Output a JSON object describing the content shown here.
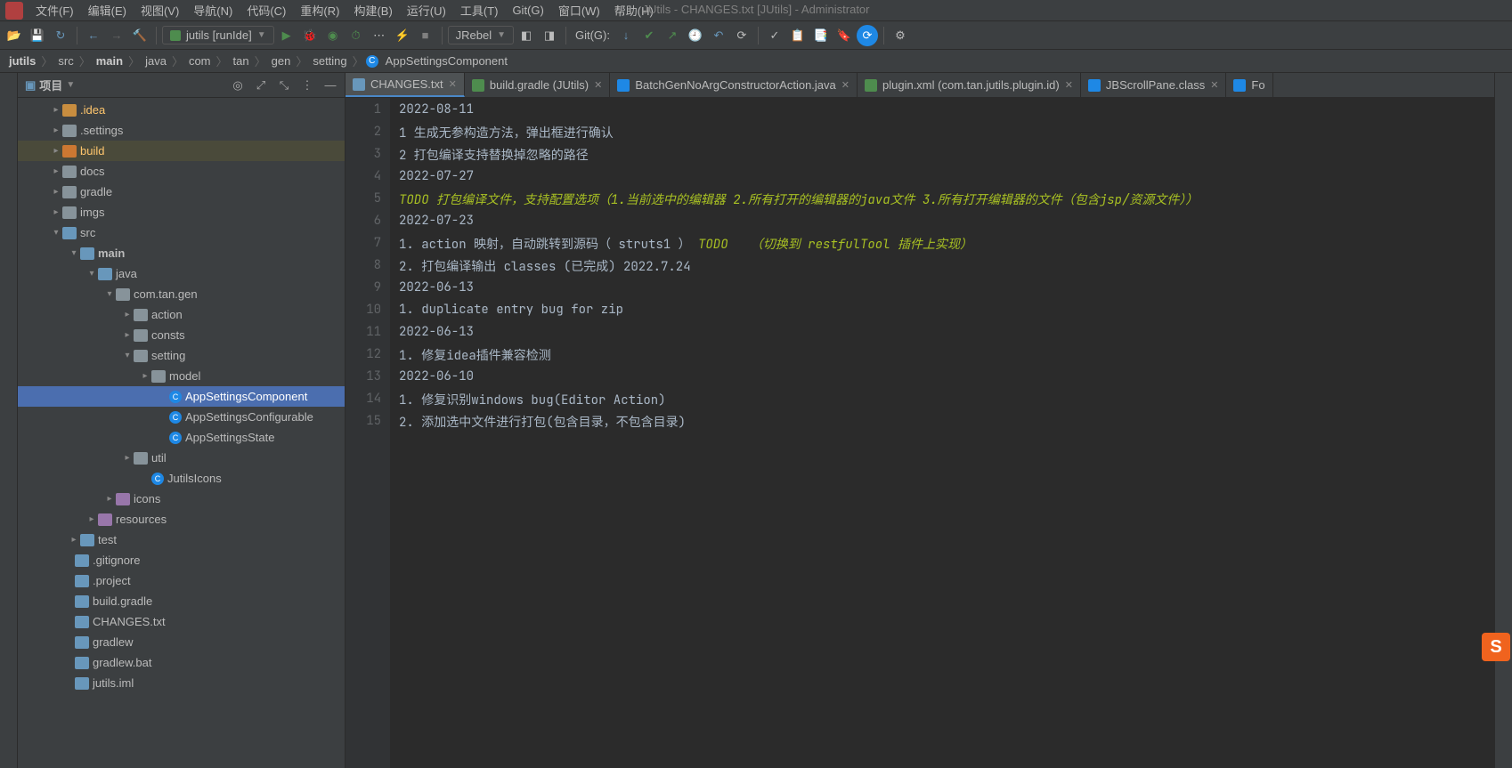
{
  "window_title": "JUtils - CHANGES.txt [JUtils] - Administrator",
  "menu": {
    "items": [
      "文件(F)",
      "编辑(E)",
      "视图(V)",
      "导航(N)",
      "代码(C)",
      "重构(R)",
      "构建(B)",
      "运行(U)",
      "工具(T)",
      "Git(G)",
      "窗口(W)",
      "帮助(H)"
    ]
  },
  "toolbar": {
    "run_config_label": "jutils [runIde]",
    "jrebel_label": "JRebel",
    "git_label": "Git(G):"
  },
  "breadcrumb": {
    "parts": [
      "jutils",
      "src",
      "main",
      "java",
      "com",
      "tan",
      "gen",
      "setting",
      "AppSettingsComponent"
    ]
  },
  "project": {
    "title": "项目",
    "tree": [
      {
        "indent": 36,
        "chevron": ">",
        "icon": "folder-orange",
        "label": ".idea",
        "yellow": true
      },
      {
        "indent": 36,
        "chevron": ">",
        "icon": "folder-icon",
        "label": ".settings"
      },
      {
        "indent": 36,
        "chevron": ">",
        "icon": "folder-red-sq",
        "label": "build",
        "yellow": true,
        "highlight": true
      },
      {
        "indent": 36,
        "chevron": ">",
        "icon": "folder-icon",
        "label": "docs"
      },
      {
        "indent": 36,
        "chevron": ">",
        "icon": "folder-icon",
        "label": "gradle"
      },
      {
        "indent": 36,
        "chevron": ">",
        "icon": "folder-icon",
        "label": "imgs"
      },
      {
        "indent": 36,
        "chevron": "v",
        "icon": "folder-blue",
        "label": "src"
      },
      {
        "indent": 56,
        "chevron": "v",
        "icon": "folder-blue",
        "label": "main",
        "bold": true
      },
      {
        "indent": 76,
        "chevron": "v",
        "icon": "folder-blue",
        "label": "java"
      },
      {
        "indent": 96,
        "chevron": "v",
        "icon": "folder-icon",
        "label": "com.tan.gen"
      },
      {
        "indent": 116,
        "chevron": ">",
        "icon": "folder-icon",
        "label": "action"
      },
      {
        "indent": 116,
        "chevron": ">",
        "icon": "folder-icon",
        "label": "consts"
      },
      {
        "indent": 116,
        "chevron": "v",
        "icon": "folder-icon",
        "label": "setting"
      },
      {
        "indent": 136,
        "chevron": ">",
        "icon": "folder-icon",
        "label": "model"
      },
      {
        "indent": 156,
        "chevron": "",
        "icon": "c-icon",
        "label": "AppSettingsComponent",
        "selected": true
      },
      {
        "indent": 156,
        "chevron": "",
        "icon": "c-icon",
        "label": "AppSettingsConfigurable"
      },
      {
        "indent": 156,
        "chevron": "",
        "icon": "c-icon",
        "label": "AppSettingsState"
      },
      {
        "indent": 116,
        "chevron": ">",
        "icon": "folder-icon",
        "label": "util"
      },
      {
        "indent": 136,
        "chevron": "",
        "icon": "c-icon",
        "label": "JutilsIcons"
      },
      {
        "indent": 96,
        "chevron": ">",
        "icon": "folder-purple",
        "label": "icons"
      },
      {
        "indent": 76,
        "chevron": ">",
        "icon": "folder-purple",
        "label": "resources"
      },
      {
        "indent": 56,
        "chevron": ">",
        "icon": "folder-blue",
        "label": "test"
      },
      {
        "indent": 50,
        "chevron": "",
        "icon": "file-icon",
        "label": ".gitignore"
      },
      {
        "indent": 50,
        "chevron": "",
        "icon": "file-icon",
        "label": ".project"
      },
      {
        "indent": 50,
        "chevron": "",
        "icon": "file-icon",
        "label": "build.gradle"
      },
      {
        "indent": 50,
        "chevron": "",
        "icon": "file-icon",
        "label": "CHANGES.txt"
      },
      {
        "indent": 50,
        "chevron": "",
        "icon": "file-icon",
        "label": "gradlew"
      },
      {
        "indent": 50,
        "chevron": "",
        "icon": "file-icon",
        "label": "gradlew.bat"
      },
      {
        "indent": 50,
        "chevron": "",
        "icon": "file-icon",
        "label": "jutils.iml"
      }
    ]
  },
  "tabs": [
    {
      "label": "CHANGES.txt",
      "icon_color": "#6897bb",
      "active": true
    },
    {
      "label": "build.gradle (JUtils)",
      "icon_color": "#4e8c4e"
    },
    {
      "label": "BatchGenNoArgConstructorAction.java",
      "icon_color": "#1e88e5"
    },
    {
      "label": "plugin.xml (com.tan.jutils.plugin.id)",
      "icon_color": "#4e8c4e"
    },
    {
      "label": "JBScrollPane.class",
      "icon_color": "#1e88e5"
    },
    {
      "label": "Fo",
      "icon_color": "#1e88e5",
      "noclose": true
    }
  ],
  "editor": {
    "lines": [
      {
        "n": 1,
        "plain": "2022-08-11"
      },
      {
        "n": 2,
        "plain": "1 生成无参构造方法，弹出框进行确认"
      },
      {
        "n": 3,
        "plain": "2 打包编译支持替换掉忽略的路径"
      },
      {
        "n": 4,
        "plain": "2022-07-27"
      },
      {
        "n": 5,
        "todo": "TODO 打包编译文件，支持配置选项（1.当前选中的编辑器 2.所有打开的编辑器的java文件 3.所有打开编辑器的文件（包含jsp/资源文件））"
      },
      {
        "n": 6,
        "plain": "2022-07-23"
      },
      {
        "n": 7,
        "mixed": true,
        "p1": "1. action 映射，自动跳转到源码（ struts1 ）",
        "t": "TODO   （切换到 restfulTool 插件上实现）"
      },
      {
        "n": 8,
        "plain": "2. 打包编译输出 classes (已完成) 2022.7.24"
      },
      {
        "n": 9,
        "plain": "2022-06-13"
      },
      {
        "n": 10,
        "plain": "1. duplicate entry bug for zip"
      },
      {
        "n": 11,
        "plain": "2022-06-13"
      },
      {
        "n": 12,
        "plain": "1. 修复idea插件兼容检测"
      },
      {
        "n": 13,
        "plain": "2022-06-10"
      },
      {
        "n": 14,
        "plain": "1. 修复识别windows bug(Editor Action)"
      },
      {
        "n": 15,
        "plain": "2. 添加选中文件进行打包(包含目录，不包含目录)"
      }
    ]
  }
}
